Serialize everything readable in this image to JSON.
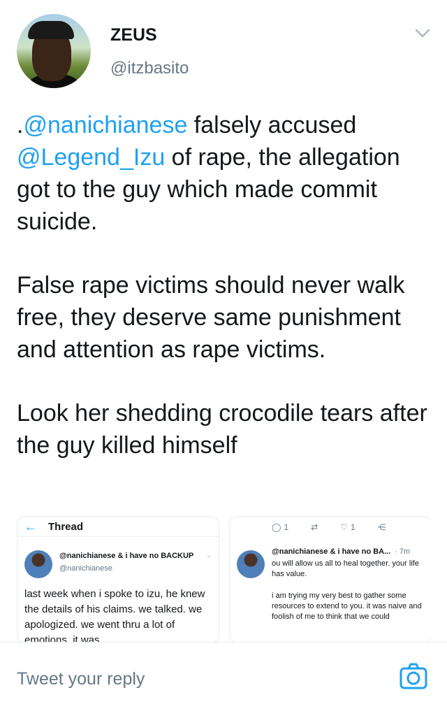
{
  "author": {
    "name": "ZEUS",
    "handle": "@itzbasito",
    "avatar_icon": "user-avatar-photo"
  },
  "tweet": {
    "para1_prefix": ".",
    "mention1": "@nanichianese",
    "para1_mid": " falsely accused ",
    "mention2": "@Legend_Izu",
    "para1_rest": " of rape, the allegation got to the guy which made commit suicide.",
    "para2": "False rape victims should never walk free, they deserve same punishment and attention as rape victims.",
    "para3": "Look her shedding crocodile tears after the guy killed himself"
  },
  "embed_left": {
    "thread_title": "Thread",
    "name": "@nanichianese & i have no BACKUP",
    "handle": "@nanichianese",
    "body": "last week when i spoke to izu, he knew the details of his claims. we talked. we apologized. we went thru a lot of emotions. it was"
  },
  "embed_right": {
    "reply_count": "1",
    "like_count": "1",
    "name": "@nanichianese & i have no BA...",
    "time": "· 7m",
    "body1": "ou will allow us all to heal together. your life has value.",
    "body2": "i am trying my very best to gather some resources to extend to you. it was naive and foolish of me to think that we could"
  },
  "reply": {
    "placeholder": "Tweet your reply"
  },
  "colors": {
    "accent": "#1da1f2",
    "secondary_text": "#657786"
  }
}
